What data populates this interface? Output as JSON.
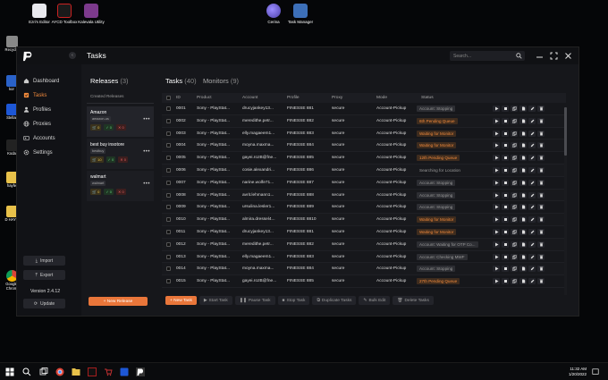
{
  "desktop": {
    "icons": [
      {
        "label": "Ezri's Editor"
      },
      {
        "label": "AYCD Toolbox"
      },
      {
        "label": "Kalevala Utility"
      },
      {
        "label": "Cerina"
      },
      {
        "label": "Task Manager"
      }
    ],
    "left_icons": [
      {
        "label": "Recycle"
      },
      {
        "label": "kor"
      },
      {
        "label": "Stellar"
      },
      {
        "label": "Koda"
      },
      {
        "label": "hayfe"
      },
      {
        "label": "D HAYF"
      },
      {
        "label": "Google Chrom"
      }
    ]
  },
  "app": {
    "page_title": "Tasks",
    "search_placeholder": "Search...",
    "sidebar": {
      "items": [
        {
          "label": "Dashboard",
          "active": false
        },
        {
          "label": "Tasks",
          "active": true
        },
        {
          "label": "Profiles",
          "active": false
        },
        {
          "label": "Proxies",
          "active": false
        },
        {
          "label": "Accounts",
          "active": false
        },
        {
          "label": "Settings",
          "active": false
        }
      ],
      "import_label": "Import",
      "export_label": "Export",
      "version": "Version 2.4.12",
      "update_label": "Update"
    },
    "releases": {
      "title": "Releases",
      "count": "(3)",
      "subheader": "Created Releases",
      "cards": [
        {
          "name": "Amazon",
          "tag": "amazon-us",
          "yellow": "0",
          "green": "0",
          "red": "0"
        },
        {
          "name": "best buy insotore",
          "tag": "bestbuy",
          "yellow": "10",
          "green": "0",
          "red": "0"
        },
        {
          "name": "walmart",
          "tag": "walmart",
          "yellow": "0",
          "green": "0",
          "red": "0"
        }
      ],
      "new_button": "+ New Release"
    },
    "tasks": {
      "tab_tasks": "Tasks",
      "tab_tasks_count": "(40)",
      "tab_monitors": "Monitors",
      "tab_monitors_count": "(9)",
      "columns": [
        "ID",
        "Product",
        "Account",
        "Profile",
        "Proxy",
        "Mode",
        "Status"
      ],
      "rows": [
        {
          "id": "0001",
          "product": "Sony - PlayStat...",
          "account": "drucyjankey13...",
          "profile": "FINESSE 881",
          "proxy": "secure",
          "mode": "Account-Pickup",
          "status": "Account: Stopping",
          "status_style": "grey"
        },
        {
          "id": "0002",
          "product": "Sony - PlayStat...",
          "account": "meredithe.petr...",
          "profile": "FINESSE 882",
          "proxy": "secure",
          "mode": "Account-Pickup",
          "status": "6th Pending Queue",
          "status_style": "orange"
        },
        {
          "id": "0003",
          "product": "Sony - PlayStat...",
          "account": "elly.magaeem1...",
          "profile": "FINESSE 883",
          "proxy": "secure",
          "mode": "Account-Pickup",
          "status": "Waiting for Monitor",
          "status_style": "orange"
        },
        {
          "id": "0004",
          "product": "Sony - PlayStat...",
          "account": "moyna.maxma...",
          "profile": "FINESSE 884",
          "proxy": "secure",
          "mode": "Account-Pickup",
          "status": "Waiting for Monitor",
          "status_style": "orange"
        },
        {
          "id": "0005",
          "product": "Sony - PlayStat...",
          "account": "gayei.rozB@fne...",
          "profile": "FINESSE 885",
          "proxy": "secure",
          "mode": "Account-Pickup",
          "status": "12th Pending Queue",
          "status_style": "orange"
        },
        {
          "id": "0006",
          "product": "Sony - PlayStat...",
          "account": "cosie.alexandri...",
          "profile": "FINESSE 886",
          "proxy": "secure",
          "mode": "Account-Pickup",
          "status": "Searching for Location",
          "status_style": "plain"
        },
        {
          "id": "0007",
          "product": "Sony - PlayStat...",
          "account": "narine.wolfe71...",
          "profile": "FINESSE 887",
          "proxy": "secure",
          "mode": "Account-Pickup",
          "status": "Account: Stopping",
          "status_style": "grey"
        },
        {
          "id": "0008",
          "product": "Sony - PlayStat...",
          "account": "avrit.lehmann1...",
          "profile": "FINESSE 888",
          "proxy": "secure",
          "mode": "Account-Pickup",
          "status": "Account: Stopping",
          "status_style": "grey"
        },
        {
          "id": "0009",
          "product": "Sony - PlayStat...",
          "account": "ursulina.lesler1...",
          "profile": "FINESSE 889",
          "proxy": "secure",
          "mode": "Account-Pickup",
          "status": "Account: Stopping",
          "status_style": "grey"
        },
        {
          "id": "0010",
          "product": "Sony - PlayStat...",
          "account": "almira.dressel4...",
          "profile": "FINESSE 8810",
          "proxy": "secure",
          "mode": "Account-Pickup",
          "status": "Waiting for Monitor",
          "status_style": "orange"
        },
        {
          "id": "0011",
          "product": "Sony - PlayStat...",
          "account": "drucyjankey13...",
          "profile": "FINESSE 881",
          "proxy": "secure",
          "mode": "Account-Pickup",
          "status": "Waiting for Monitor",
          "status_style": "orange"
        },
        {
          "id": "0012",
          "product": "Sony - PlayStat...",
          "account": "meredithe.petr...",
          "profile": "FINESSE 882",
          "proxy": "secure",
          "mode": "Account-Pickup",
          "status": "Account: Waiting for OTP Co...",
          "status_style": "grey"
        },
        {
          "id": "0013",
          "product": "Sony - PlayStat...",
          "account": "elly.magaeem1...",
          "profile": "FINESSE 883",
          "proxy": "secure",
          "mode": "Account-Pickup",
          "status": "Account: Checking MWF",
          "status_style": "grey"
        },
        {
          "id": "0014",
          "product": "Sony - PlayStat...",
          "account": "moyna.maxma...",
          "profile": "FINESSE 884",
          "proxy": "secure",
          "mode": "Account-Pickup",
          "status": "Account: Stopping",
          "status_style": "grey"
        },
        {
          "id": "0015",
          "product": "Sony - PlayStat...",
          "account": "gayei.rozB@fne...",
          "profile": "FINESSE 885",
          "proxy": "secure",
          "mode": "Account-Pickup",
          "status": "27th Pending Queue",
          "status_style": "orange"
        }
      ],
      "toolbar": {
        "new_task": "+ New Task",
        "start_task": "Start Task",
        "pause_task": "Pause Task",
        "stop_task": "Stop Task",
        "duplicate_tasks": "Duplicate Tasks",
        "bulk_edit": "Bulk Edit",
        "delete_tasks": "Delete Tasks"
      }
    }
  },
  "taskbar": {
    "time": "11:32 AM",
    "date": "1/20/2022"
  },
  "colors": {
    "accent": "#e9763a",
    "window_bg": "#16171b",
    "sidebar_bg": "#111216"
  }
}
